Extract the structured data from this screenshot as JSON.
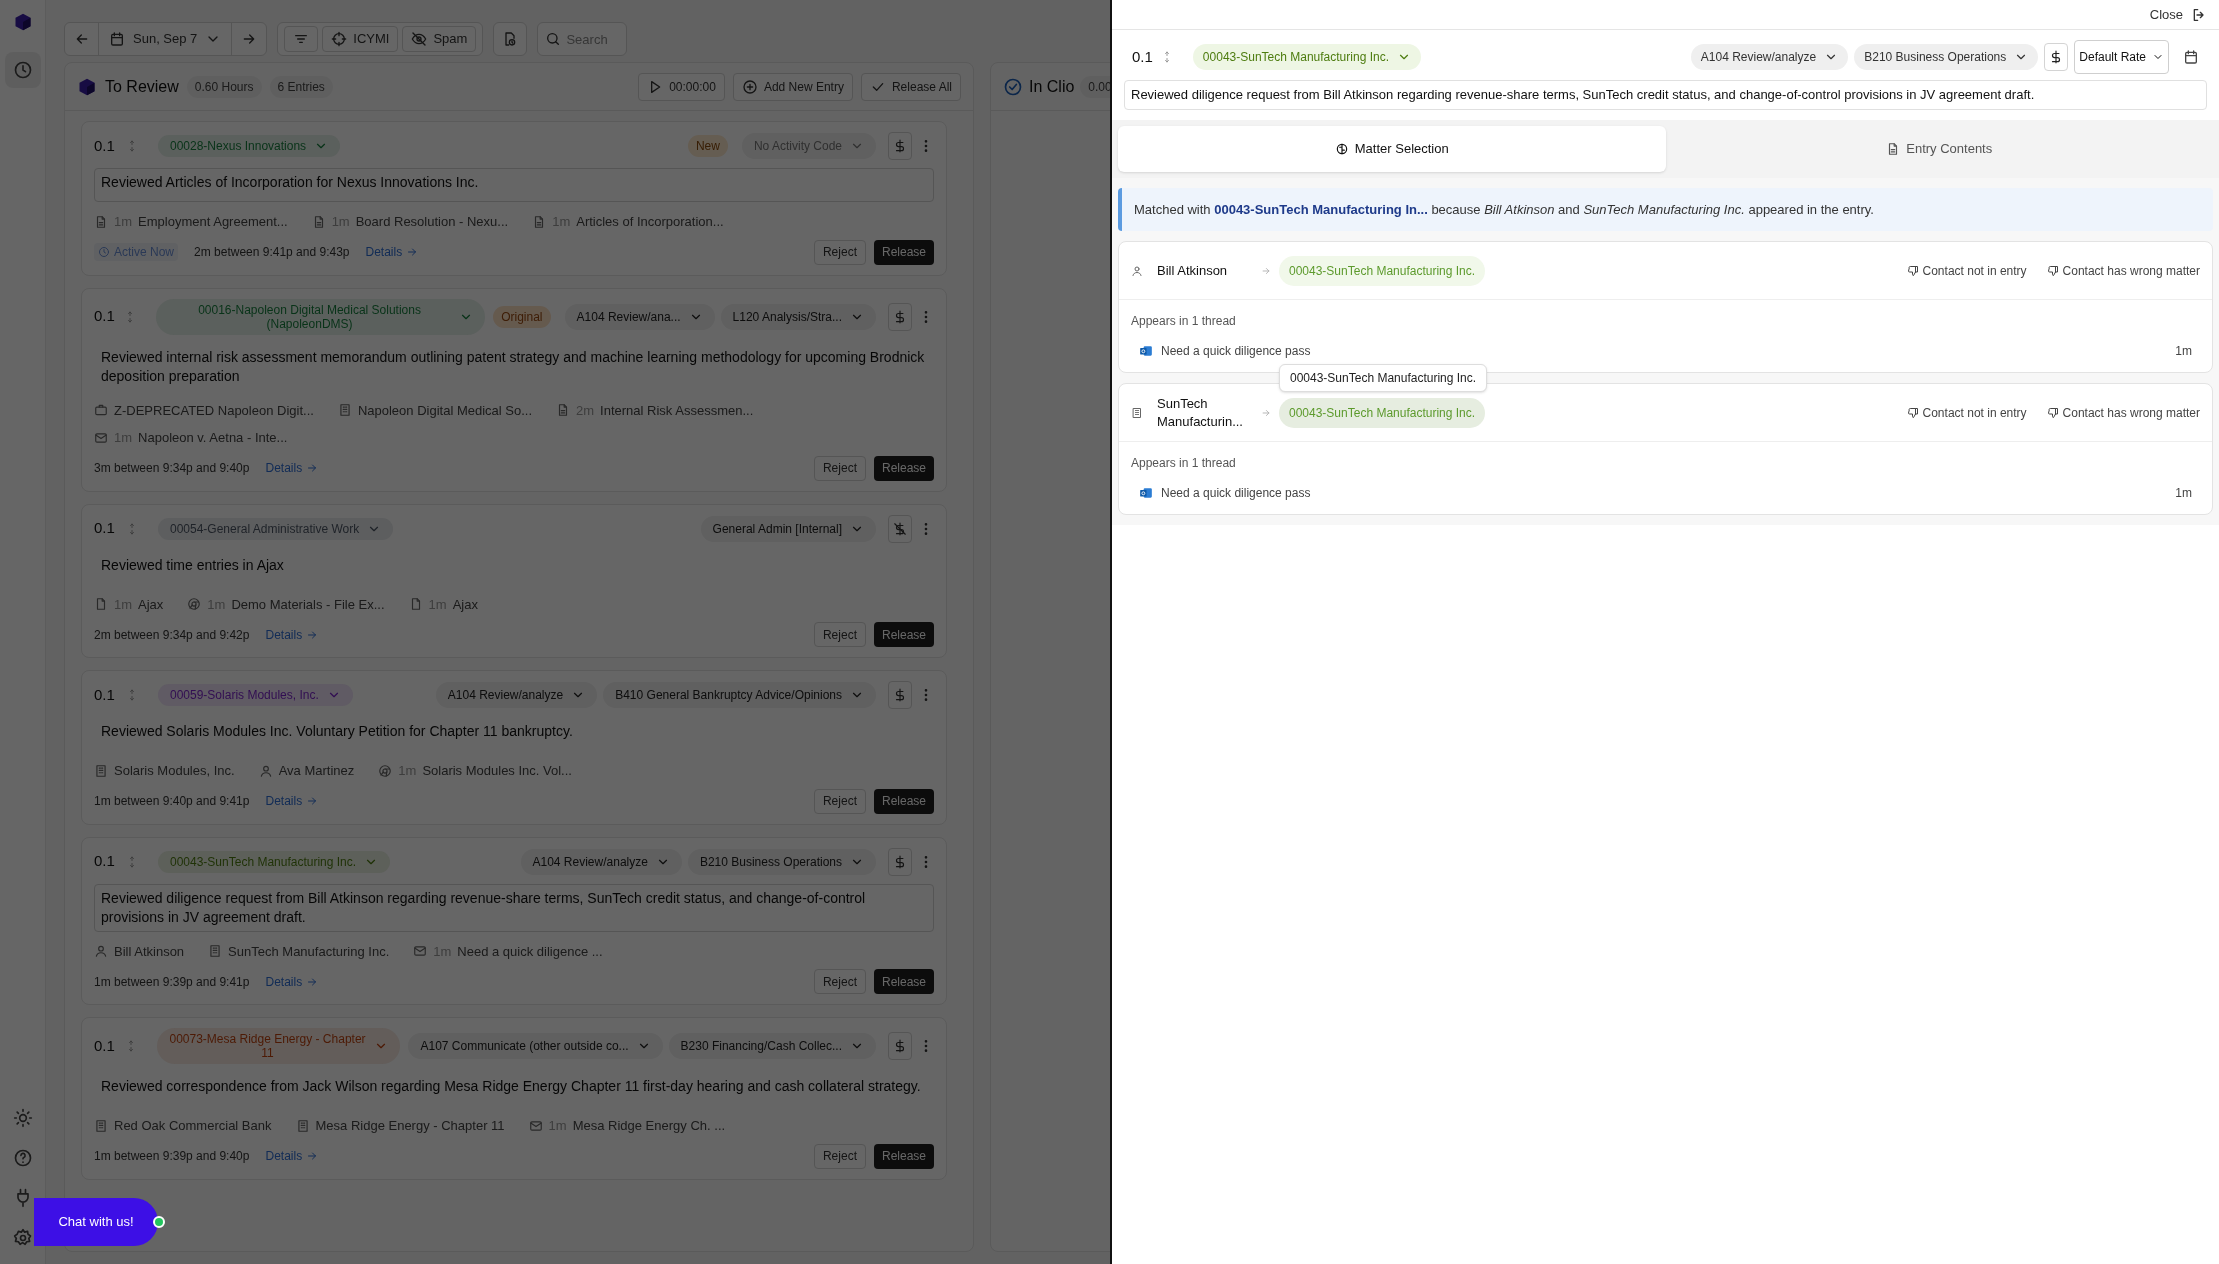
{
  "toolbar": {
    "date": "Sun, Sep 7",
    "filters": [
      "ICYMI",
      "Spam"
    ],
    "search": {
      "placeholder": "Search"
    }
  },
  "review": {
    "title": "To Review",
    "hours": "0.60 Hours",
    "count": "6 Entries",
    "timer": "00:00:00",
    "add": "Add New Entry",
    "release_all": "Release All"
  },
  "entries": [
    {
      "duration": "0.1",
      "matter": "00028-Nexus Innovations",
      "color": "#083318",
      "badge": {
        "kind": "new",
        "text": "New"
      },
      "codes": [
        {
          "text": "No Activity Code",
          "muted": true
        }
      ],
      "billable": true,
      "focused": true,
      "description": "Reviewed Articles of Incorporation for Nexus Innovations Inc.",
      "sources": [
        {
          "kind": "doc",
          "time": "1m",
          "label": "Employment Agreement..."
        },
        {
          "kind": "doc",
          "time": "1m",
          "label": "Board Resolution - Nexu..."
        },
        {
          "kind": "doc",
          "time": "1m",
          "label": "Articles of Incorporation..."
        }
      ],
      "status": "Active Now",
      "summary": "2m between 9:41p and 9:43p",
      "details": "Details",
      "actions": [
        "Reject",
        "Release"
      ]
    },
    {
      "duration": "0.1",
      "matter": "00016-Napoleon Digital Medical Solutions (NapoleonDMS)",
      "color": "#083318",
      "badge": {
        "kind": "original",
        "text": "Original"
      },
      "codes": [
        {
          "text": "A104 Review/ana...",
          "muted": false
        },
        {
          "text": "L120 Analysis/Stra...",
          "muted": false
        }
      ],
      "billable": true,
      "focused": false,
      "description": "Reviewed internal risk assessment memorandum outlining patent strategy and machine learning methodology for upcoming Brodnick deposition preparation",
      "sources": [
        {
          "kind": "briefcase",
          "label": "Z-DEPRECATED Napoleon Digit..."
        },
        {
          "kind": "building",
          "label": "Napoleon Digital Medical So..."
        },
        {
          "kind": "doc",
          "time": "2m",
          "label": "Internal Risk Assessmen..."
        },
        {
          "kind": "mail",
          "time": "1m",
          "label": "Napoleon v. Aetna - Inte..."
        }
      ],
      "summary": "3m between 9:34p and 9:40p",
      "details": "Details",
      "actions": [
        "Reject",
        "Release"
      ]
    },
    {
      "duration": "0.1",
      "matter": "00054-General Administrative Work",
      "color": "#1e2228",
      "codes": [
        {
          "text": "General Admin [Internal]",
          "muted": false
        }
      ],
      "billable": false,
      "focused": false,
      "description": "Reviewed time entries in Ajax",
      "sources": [
        {
          "kind": "file",
          "time": "1m",
          "label": "Ajax"
        },
        {
          "kind": "globe",
          "time": "1m",
          "label": "Demo Materials - File Ex..."
        },
        {
          "kind": "file",
          "time": "1m",
          "label": "Ajax"
        }
      ],
      "summary": "2m between 9:34p and 9:42p",
      "details": "Details",
      "actions": [
        "Reject",
        "Release"
      ]
    },
    {
      "duration": "0.1",
      "matter": "00059-Solaris Modules, Inc.",
      "color": "#320e52",
      "codes": [
        {
          "text": "A104 Review/analyze",
          "muted": false
        },
        {
          "text": "B410 General Bankruptcy Advice/Opinions",
          "muted": false
        }
      ],
      "billable": true,
      "focused": false,
      "description": "Reviewed Solaris Modules Inc. Voluntary Petition for Chapter 11 bankruptcy.",
      "sources": [
        {
          "kind": "building",
          "label": "Solaris Modules, Inc."
        },
        {
          "kind": "person",
          "label": "Ava Martinez"
        },
        {
          "kind": "globe",
          "time": "1m",
          "label": "Solaris Modules Inc. Vol..."
        }
      ],
      "summary": "1m between 9:40p and 9:41p",
      "details": "Details",
      "actions": [
        "Reject",
        "Release"
      ]
    },
    {
      "duration": "0.1",
      "matter": "00043-SunTech Manufacturing Inc.",
      "color": "#1f3206",
      "codes": [
        {
          "text": "A104 Review/analyze",
          "muted": false
        },
        {
          "text": "B210 Business Operations",
          "muted": false
        }
      ],
      "billable": true,
      "focused": true,
      "description": "Reviewed diligence request from Bill Atkinson regarding revenue-share terms, SunTech credit status, and change-of-control provisions in JV agreement draft.",
      "sources": [
        {
          "kind": "person",
          "label": "Bill Atkinson"
        },
        {
          "kind": "building",
          "label": "SunTech Manufacturing Inc."
        },
        {
          "kind": "mail",
          "time": "1m",
          "label": "Need a quick diligence ..."
        }
      ],
      "summary": "1m between 9:39p and 9:41p",
      "details": "Details",
      "actions": [
        "Reject",
        "Release"
      ]
    },
    {
      "duration": "0.1",
      "matter": "00073-Mesa Ridge Energy - Chapter 11",
      "color": "#4d1a05",
      "codes": [
        {
          "text": "A107 Communicate (other outside co...",
          "muted": false
        },
        {
          "text": "B230 Financing/Cash Collec...",
          "muted": false
        }
      ],
      "billable": true,
      "focused": false,
      "description": "Reviewed correspondence from Jack Wilson regarding Mesa Ridge Energy Chapter 11 first-day hearing and cash collateral strategy.",
      "sources": [
        {
          "kind": "building",
          "label": "Red Oak Commercial Bank"
        },
        {
          "kind": "building",
          "label": "Mesa Ridge Energy - Chapter 11"
        },
        {
          "kind": "mail",
          "time": "1m",
          "label": "Mesa Ridge Energy Ch. ..."
        }
      ],
      "summary": "1m between 9:39p and 9:40p",
      "details": "Details",
      "actions": [
        "Reject",
        "Release"
      ]
    }
  ],
  "in_clio": {
    "title": "In Clio",
    "hours": "0.00"
  },
  "chat": {
    "label": "Chat with us!",
    "online": true
  },
  "drawer": {
    "close": "Close",
    "duration": "0.1",
    "matter": "00043-SunTech Manufacturing Inc.",
    "codes": [
      "A104 Review/analyze",
      "B210 Business Operations"
    ],
    "rate": "Default Rate",
    "description": "Reviewed diligence request from Bill Atkinson regarding revenue-share terms, SunTech credit status, and change-of-control provisions in JV agreement draft.",
    "tabs": [
      {
        "label": "Matter Selection",
        "selected": true
      },
      {
        "label": "Entry Contents",
        "selected": false
      }
    ],
    "note": "Matched with **00043-SunTech Manufacturing In...** because *Bill Atkinson* and *SunTech Manufacturing Inc.* appeared in the entry.",
    "contacts": [
      {
        "kind": "person",
        "name": "Bill Atkinson",
        "matter": "00043-SunTech Manufacturing Inc.",
        "actions": [
          "Contact not in entry",
          "Contact has wrong matter"
        ],
        "appears": "Appears in 1 thread",
        "threads": [
          {
            "title": "Need a quick diligence pass",
            "time": "1m"
          }
        ]
      },
      {
        "kind": "company",
        "name": "SunTech Manufacturin...",
        "matter": "00043-SunTech Manufacturing Inc.",
        "tooltip": "00043-SunTech Manufacturing Inc.",
        "actions": [
          "Contact not in entry",
          "Contact has wrong matter"
        ],
        "appears": "Appears in 1 thread",
        "threads": [
          {
            "title": "Need a quick diligence pass",
            "time": "1m"
          }
        ]
      }
    ]
  }
}
